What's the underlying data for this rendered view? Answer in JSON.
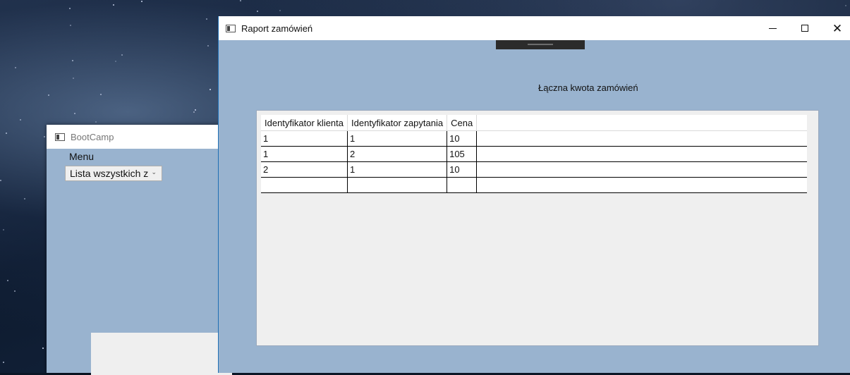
{
  "bootcamp_window": {
    "title": "BootCamp",
    "menu_label": "Menu",
    "combo_value": "Lista wszystkich z"
  },
  "report_window": {
    "title": "Raport zamówień",
    "total_label": "Łączna kwota zamówień",
    "grid": {
      "columns": [
        "Identyfikator klienta",
        "Identyfikator zapytania",
        "Cena"
      ],
      "rows": [
        [
          "1",
          "1",
          "10"
        ],
        [
          "1",
          "2",
          "105"
        ],
        [
          "2",
          "1",
          "10"
        ],
        [
          "",
          "",
          ""
        ]
      ]
    }
  },
  "icons": {
    "app": "app-window-icon",
    "minimize": "minimize-icon",
    "maximize": "maximize-icon",
    "close": "close-icon",
    "dropdown": "chevron-down-icon"
  }
}
